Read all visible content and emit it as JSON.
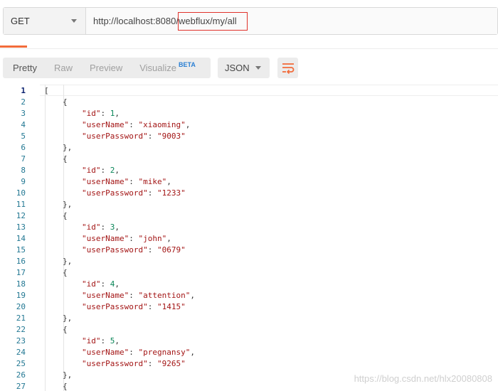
{
  "request": {
    "method": "GET",
    "url_prefix": "http://localhost:8080/",
    "url_highlight": "webflux/my/all"
  },
  "response_toolbar": {
    "views": [
      "Pretty",
      "Raw",
      "Preview",
      "Visualize"
    ],
    "beta_label": "BETA",
    "format": "JSON",
    "wrap_icon": "wrap-lines-icon",
    "accent_color": "#f26b3a"
  },
  "code_lines": [
    {
      "n": "1",
      "indent": 0,
      "parts": [
        [
          "p",
          "["
        ]
      ]
    },
    {
      "n": "2",
      "indent": 1,
      "parts": [
        [
          "p",
          "{"
        ]
      ]
    },
    {
      "n": "3",
      "indent": 2,
      "parts": [
        [
          "k",
          "\"id\""
        ],
        [
          "p",
          ": "
        ],
        [
          "n",
          "1"
        ],
        [
          "p",
          ","
        ]
      ]
    },
    {
      "n": "4",
      "indent": 2,
      "parts": [
        [
          "k",
          "\"userName\""
        ],
        [
          "p",
          ": "
        ],
        [
          "s",
          "\"xiaoming\""
        ],
        [
          "p",
          ","
        ]
      ]
    },
    {
      "n": "5",
      "indent": 2,
      "parts": [
        [
          "k",
          "\"userPassword\""
        ],
        [
          "p",
          ": "
        ],
        [
          "s",
          "\"9003\""
        ]
      ]
    },
    {
      "n": "6",
      "indent": 1,
      "parts": [
        [
          "p",
          "},"
        ]
      ]
    },
    {
      "n": "7",
      "indent": 1,
      "parts": [
        [
          "p",
          "{"
        ]
      ]
    },
    {
      "n": "8",
      "indent": 2,
      "parts": [
        [
          "k",
          "\"id\""
        ],
        [
          "p",
          ": "
        ],
        [
          "n",
          "2"
        ],
        [
          "p",
          ","
        ]
      ]
    },
    {
      "n": "9",
      "indent": 2,
      "parts": [
        [
          "k",
          "\"userName\""
        ],
        [
          "p",
          ": "
        ],
        [
          "s",
          "\"mike\""
        ],
        [
          "p",
          ","
        ]
      ]
    },
    {
      "n": "10",
      "indent": 2,
      "parts": [
        [
          "k",
          "\"userPassword\""
        ],
        [
          "p",
          ": "
        ],
        [
          "s",
          "\"1233\""
        ]
      ]
    },
    {
      "n": "11",
      "indent": 1,
      "parts": [
        [
          "p",
          "},"
        ]
      ]
    },
    {
      "n": "12",
      "indent": 1,
      "parts": [
        [
          "p",
          "{"
        ]
      ]
    },
    {
      "n": "13",
      "indent": 2,
      "parts": [
        [
          "k",
          "\"id\""
        ],
        [
          "p",
          ": "
        ],
        [
          "n",
          "3"
        ],
        [
          "p",
          ","
        ]
      ]
    },
    {
      "n": "14",
      "indent": 2,
      "parts": [
        [
          "k",
          "\"userName\""
        ],
        [
          "p",
          ": "
        ],
        [
          "s",
          "\"john\""
        ],
        [
          "p",
          ","
        ]
      ]
    },
    {
      "n": "15",
      "indent": 2,
      "parts": [
        [
          "k",
          "\"userPassword\""
        ],
        [
          "p",
          ": "
        ],
        [
          "s",
          "\"0679\""
        ]
      ]
    },
    {
      "n": "16",
      "indent": 1,
      "parts": [
        [
          "p",
          "},"
        ]
      ]
    },
    {
      "n": "17",
      "indent": 1,
      "parts": [
        [
          "p",
          "{"
        ]
      ]
    },
    {
      "n": "18",
      "indent": 2,
      "parts": [
        [
          "k",
          "\"id\""
        ],
        [
          "p",
          ": "
        ],
        [
          "n",
          "4"
        ],
        [
          "p",
          ","
        ]
      ]
    },
    {
      "n": "19",
      "indent": 2,
      "parts": [
        [
          "k",
          "\"userName\""
        ],
        [
          "p",
          ": "
        ],
        [
          "s",
          "\"attention\""
        ],
        [
          "p",
          ","
        ]
      ]
    },
    {
      "n": "20",
      "indent": 2,
      "parts": [
        [
          "k",
          "\"userPassword\""
        ],
        [
          "p",
          ": "
        ],
        [
          "s",
          "\"1415\""
        ]
      ]
    },
    {
      "n": "21",
      "indent": 1,
      "parts": [
        [
          "p",
          "},"
        ]
      ]
    },
    {
      "n": "22",
      "indent": 1,
      "parts": [
        [
          "p",
          "{"
        ]
      ]
    },
    {
      "n": "23",
      "indent": 2,
      "parts": [
        [
          "k",
          "\"id\""
        ],
        [
          "p",
          ": "
        ],
        [
          "n",
          "5"
        ],
        [
          "p",
          ","
        ]
      ]
    },
    {
      "n": "24",
      "indent": 2,
      "parts": [
        [
          "k",
          "\"userName\""
        ],
        [
          "p",
          ": "
        ],
        [
          "s",
          "\"pregnansy\""
        ],
        [
          "p",
          ","
        ]
      ]
    },
    {
      "n": "25",
      "indent": 2,
      "parts": [
        [
          "k",
          "\"userPassword\""
        ],
        [
          "p",
          ": "
        ],
        [
          "s",
          "\"9265\""
        ]
      ]
    },
    {
      "n": "26",
      "indent": 1,
      "parts": [
        [
          "p",
          "},"
        ]
      ]
    },
    {
      "n": "27",
      "indent": 1,
      "parts": [
        [
          "p",
          "{"
        ]
      ]
    }
  ],
  "watermark": "https://blog.csdn.net/hlx20080808"
}
